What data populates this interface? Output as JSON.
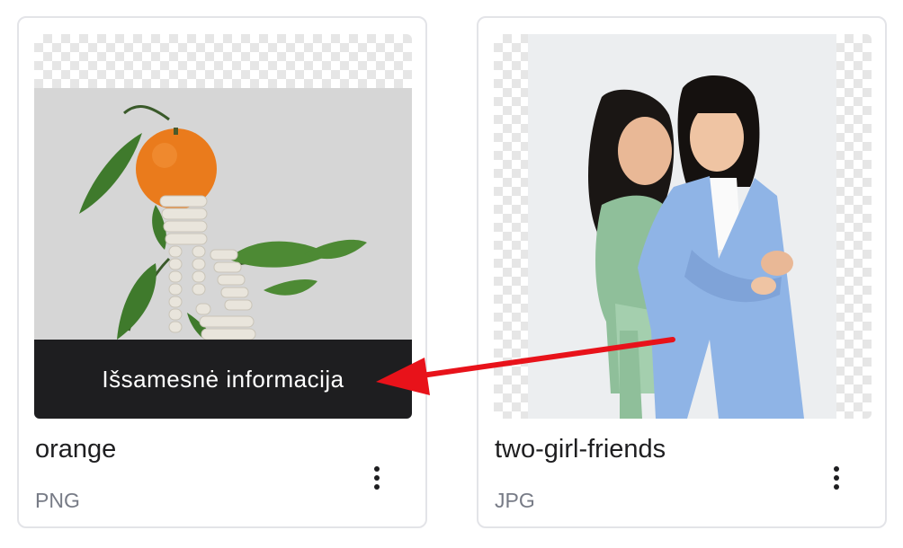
{
  "cards": [
    {
      "name": "orange",
      "type": "PNG",
      "overlay_label": "Išsamesnė informacija"
    },
    {
      "name": "two-girl-friends",
      "type": "JPG"
    }
  ],
  "icons": {
    "more": "more-vertical-icon",
    "annotation": "red-arrow-annotation"
  },
  "colors": {
    "overlay_background": "#1e1e20",
    "text_primary": "#1e1e20",
    "text_secondary": "#777b86",
    "card_border": "#e3e4e8",
    "annotation_arrow": "#e8121a"
  }
}
